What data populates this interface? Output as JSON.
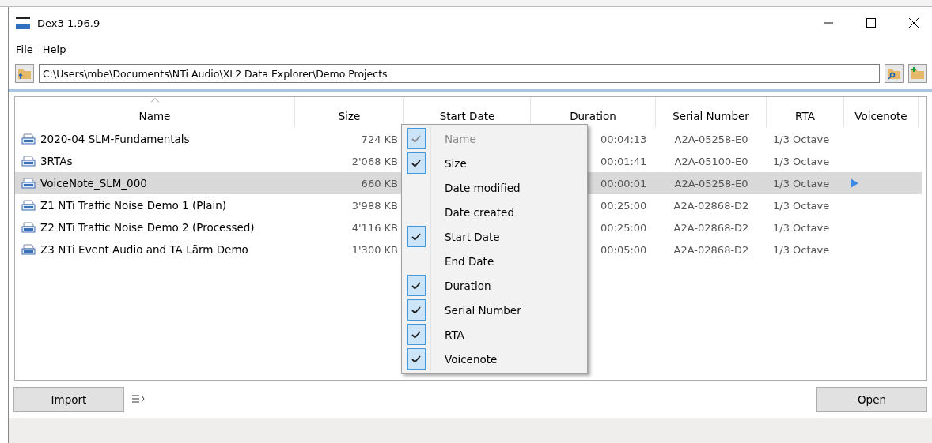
{
  "window": {
    "title": "Dex3 1.96.9"
  },
  "menu": [
    "File",
    "Help"
  ],
  "path": {
    "value": "C:\\Users\\mbe\\Documents\\NTi Audio\\XL2 Data Explorer\\Demo Projects"
  },
  "table": {
    "columns": [
      {
        "label": "Name",
        "sorted": true
      },
      {
        "label": "Size",
        "sorted": false
      },
      {
        "label": "Start Date",
        "sorted": false
      },
      {
        "label": "Duration",
        "sorted": false
      },
      {
        "label": "Serial Number",
        "sorted": false
      },
      {
        "label": "RTA",
        "sorted": false
      },
      {
        "label": "Voicenote",
        "sorted": false
      }
    ],
    "rows": [
      {
        "name": "2020-04 SLM-Fundamentals",
        "size": "724 KB",
        "duration": "00:04:13",
        "serial": "A2A-05258-E0",
        "rta": "1/3 Octave",
        "selected": false
      },
      {
        "name": "3RTAs",
        "size": "2'068 KB",
        "duration": "00:01:41",
        "serial": "A2A-05100-E0",
        "rta": "1/3 Octave",
        "selected": false
      },
      {
        "name": "VoiceNote_SLM_000",
        "size": "660 KB",
        "duration": "00:00:01",
        "serial": "A2A-05258-E0",
        "rta": "1/3 Octave",
        "voicenote": true,
        "selected": true
      },
      {
        "name": "Z1 NTi Traffic Noise Demo 1 (Plain)",
        "size": "3'988 KB",
        "duration": "00:25:00",
        "serial": "A2A-02868-D2",
        "rta": "1/3 Octave",
        "selected": false
      },
      {
        "name": "Z2 NTi Traffic Noise Demo 2 (Processed)",
        "size": "4'116 KB",
        "duration": "00:25:00",
        "serial": "A2A-02868-D2",
        "rta": "1/3 Octave",
        "selected": false
      },
      {
        "name": "Z3 NTi Event Audio and TA Lärm Demo",
        "size": "1'300 KB",
        "duration": "00:05:00",
        "serial": "A2A-02868-D2",
        "rta": "1/3 Octave",
        "selected": false
      }
    ]
  },
  "column_menu": [
    {
      "label": "Name",
      "checked": true,
      "disabled": true
    },
    {
      "label": "Size",
      "checked": true,
      "disabled": false
    },
    {
      "label": "Date modified",
      "checked": false,
      "disabled": false
    },
    {
      "label": "Date created",
      "checked": false,
      "disabled": false
    },
    {
      "label": "Start Date",
      "checked": true,
      "disabled": false
    },
    {
      "label": "End Date",
      "checked": false,
      "disabled": false
    },
    {
      "label": "Duration",
      "checked": true,
      "disabled": false
    },
    {
      "label": "Serial Number",
      "checked": true,
      "disabled": false
    },
    {
      "label": "RTA",
      "checked": true,
      "disabled": false
    },
    {
      "label": "Voicenote",
      "checked": true,
      "disabled": false
    }
  ],
  "buttons": {
    "import": "Import",
    "open": "Open"
  }
}
